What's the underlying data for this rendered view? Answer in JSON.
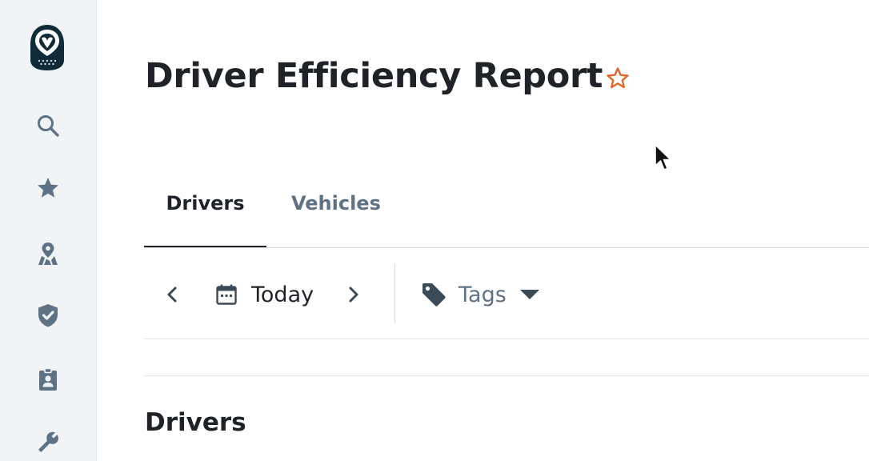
{
  "header": {
    "title": "Driver Efficiency Report"
  },
  "tabs": [
    {
      "label": "Drivers",
      "active": true
    },
    {
      "label": "Vehicles",
      "active": false
    }
  ],
  "toolbar": {
    "date_label": "Today",
    "tags_label": "Tags"
  },
  "section": {
    "title": "Drivers"
  },
  "sidebar": {
    "items": [
      {
        "icon": "search-icon"
      },
      {
        "icon": "star-icon"
      },
      {
        "icon": "map-pin-icon"
      },
      {
        "icon": "shield-check-icon"
      },
      {
        "icon": "id-badge-icon"
      },
      {
        "icon": "wrench-icon"
      }
    ]
  },
  "colors": {
    "sidebar_bg": "#f1f4f6",
    "logo_bg": "#0f2b3a",
    "icon_gray": "#5d7285",
    "favorite_star": "#e0692a",
    "text_dark": "#1f2328"
  }
}
